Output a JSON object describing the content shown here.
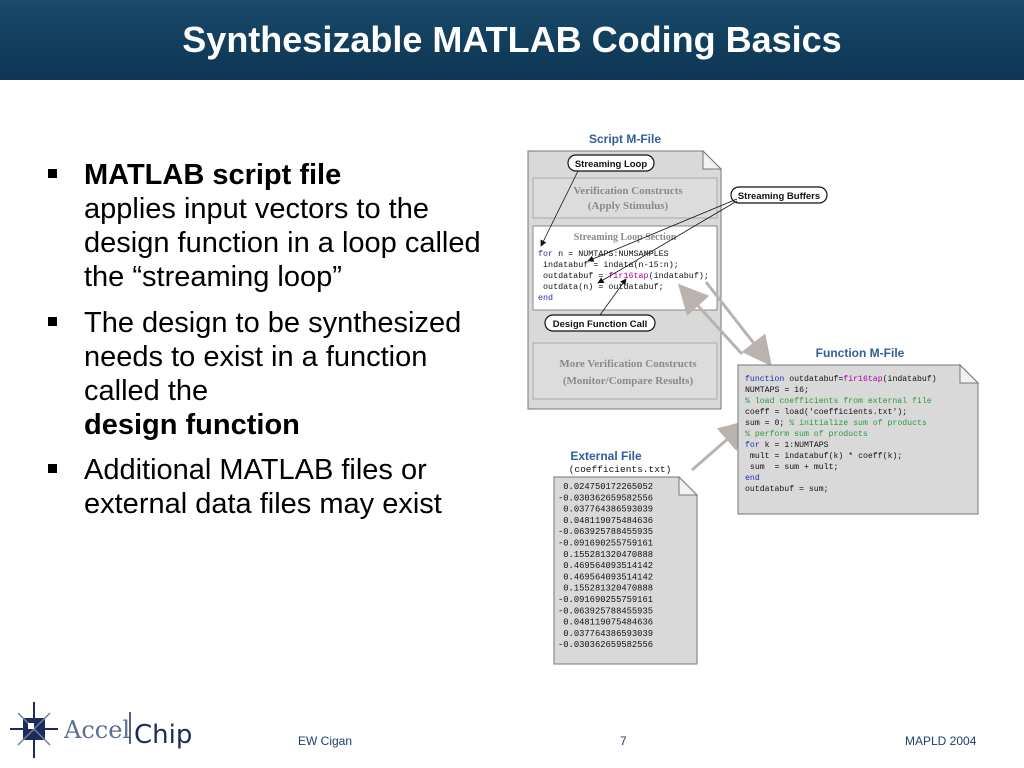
{
  "slide": {
    "title": "Synthesizable MATLAB Coding Basics",
    "bullets": [
      {
        "bold": "MATLAB script file",
        "text": "applies input vectors to the design function in a loop called the “streaming loop”",
        "bold_after": ""
      },
      {
        "bold": "",
        "text": "The design to be synthesized needs to exist in a function called the",
        "bold_after": "design function"
      },
      {
        "bold": "",
        "text": "Additional MATLAB files or external data files may exist",
        "bold_after": ""
      }
    ]
  },
  "diagram": {
    "script_label": "Script M-File",
    "callout_streaming_loop": "Streaming Loop",
    "callout_streaming_buffers": "Streaming Buffers",
    "callout_design_call": "Design Function Call",
    "verification_line1": "Verification Constructs",
    "verification_line2": "(Apply Stimulus)",
    "loop_section_title": "Streaming Loop Section",
    "loop_code": [
      "for n = NUMTAPS:NUMSAMPLES",
      " indatabuf = indata(n-15:n);",
      " outdatabuf = fir16tap(indatabuf);",
      " outdata(n) = outdatabuf;",
      "end"
    ],
    "more_verification_line1": "More Verification Constructs",
    "more_verification_line2": "(Monitor/Compare Results)",
    "function_label": "Function M-File",
    "function_code": [
      "function outdatabuf=fir16tap(indatabuf)",
      "NUMTAPS = 16;",
      "% load coefficients from external file",
      "coeff = load('coefficients.txt');",
      "sum = 0; % initialize sum of products",
      "% perform sum of products",
      "for k = 1:NUMTAPS",
      " mult = indatabuf(k) * coeff(k);",
      " sum  = sum + mult;",
      "end",
      "outdatabuf = sum;"
    ],
    "external_label": "External File",
    "external_filename": "(coefficients.txt)",
    "coefficients": [
      " 0.024750172265052",
      "-0.030362659582556",
      " 0.037764386593039",
      " 0.048119075484636",
      "-0.063925788455935",
      "-0.091690255759161",
      " 0.155281320470888",
      " 0.469564093514142",
      " 0.469564093514142",
      " 0.155281320470888",
      "-0.091690255759161",
      "-0.063925788455935",
      " 0.048119075484636",
      " 0.037764386593039",
      "-0.030362659582556"
    ]
  },
  "footer": {
    "author": "EW Cigan",
    "page": "7",
    "event": "MAPLD 2004"
  },
  "logo": {
    "text_left": "Accel",
    "text_right": "Chip"
  },
  "colors": {
    "title_bg": "#0c3552",
    "diagram_label": "#2f5f9a",
    "keyword": "#1f2fb0",
    "function_name": "#b000a0",
    "comment": "#2a9a3a"
  }
}
